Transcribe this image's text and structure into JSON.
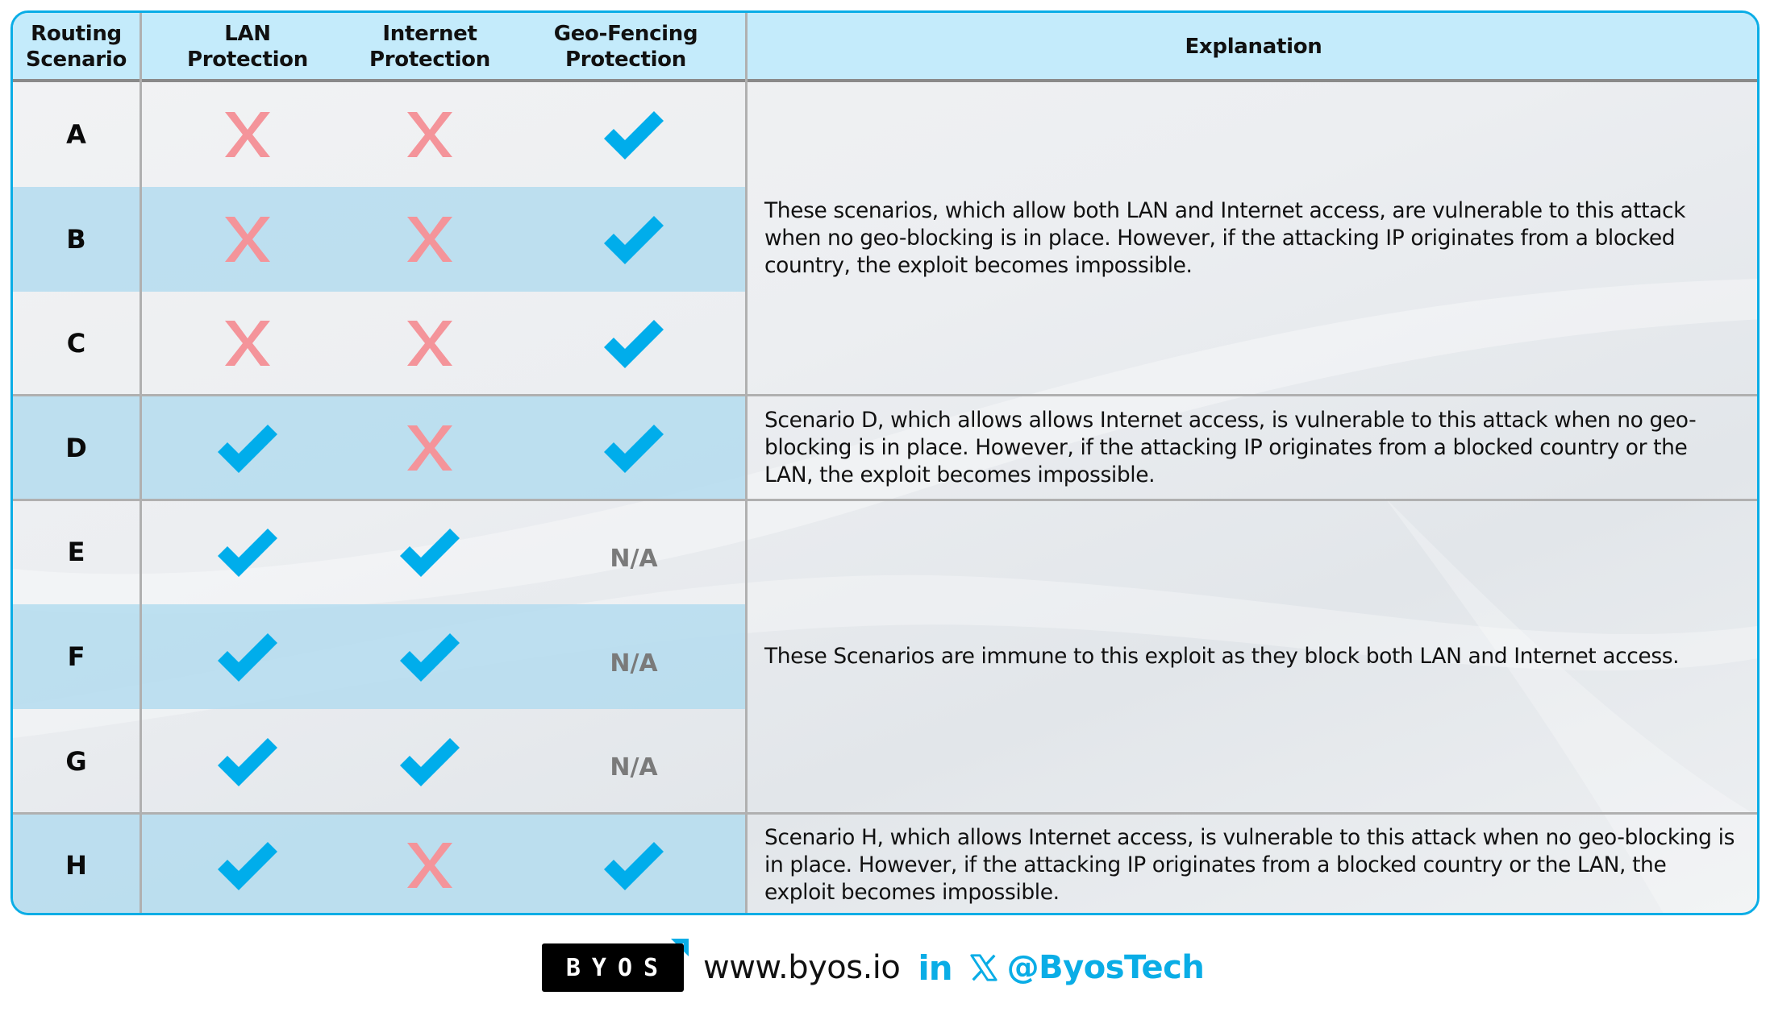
{
  "table": {
    "headers": {
      "scenario": [
        "Routing",
        "Scenario"
      ],
      "lan": [
        "LAN",
        "Protection"
      ],
      "internet": [
        "Internet",
        "Protection"
      ],
      "geo": [
        "Geo-Fencing",
        "Protection"
      ],
      "explanation": "Explanation"
    },
    "rows": [
      {
        "scenario": "A",
        "lan": "cross",
        "internet": "cross",
        "geo": "check",
        "shade": "light"
      },
      {
        "scenario": "B",
        "lan": "cross",
        "internet": "cross",
        "geo": "check",
        "shade": "blue"
      },
      {
        "scenario": "C",
        "lan": "cross",
        "internet": "cross",
        "geo": "check",
        "shade": "light"
      },
      {
        "scenario": "D",
        "lan": "check",
        "internet": "cross",
        "geo": "check",
        "shade": "blue"
      },
      {
        "scenario": "E",
        "lan": "check",
        "internet": "check",
        "geo": "N/A",
        "shade": "light"
      },
      {
        "scenario": "F",
        "lan": "check",
        "internet": "check",
        "geo": "N/A",
        "shade": "blue"
      },
      {
        "scenario": "G",
        "lan": "check",
        "internet": "check",
        "geo": "N/A",
        "shade": "light"
      },
      {
        "scenario": "H",
        "lan": "check",
        "internet": "cross",
        "geo": "check",
        "shade": "blue"
      }
    ],
    "explanations": [
      {
        "rows": [
          "A",
          "B",
          "C"
        ],
        "text": "These scenarios, which allow both LAN and Internet access, are vulnerable to this attack when no geo-blocking is in place. However, if the attacking IP originates from a blocked country, the exploit becomes impossible."
      },
      {
        "rows": [
          "D"
        ],
        "text": "Scenario D, which allows allows Internet access, is vulnerable to this attack when no geo-blocking is in place. However, if the attacking IP originates from a blocked country or the LAN, the exploit becomes impossible."
      },
      {
        "rows": [
          "E",
          "F",
          "G"
        ],
        "text": "These Scenarios are immune to this exploit as they block both LAN and Internet access."
      },
      {
        "rows": [
          "H"
        ],
        "text": "Scenario H, which allows Internet access, is vulnerable to this attack when no geo-blocking is in place. However, if the attacking IP originates from a blocked country or the LAN, the exploit becomes impossible."
      }
    ],
    "icons": {
      "check": "check-icon",
      "cross": "cross-icon"
    }
  },
  "footer": {
    "logo_text": "BYOS",
    "website": "www.byos.io",
    "linkedin_label": "in",
    "x_icon": "x-logo-icon",
    "handle": "@ByosTech"
  },
  "colors": {
    "accent": "#0aade6",
    "check": "#00adeb",
    "cross": "#f4949a",
    "na": "#7a7a7a",
    "header_bg": "#c4ebfb",
    "row_blue": "#b8deee",
    "row_light": "#eef0f2"
  }
}
